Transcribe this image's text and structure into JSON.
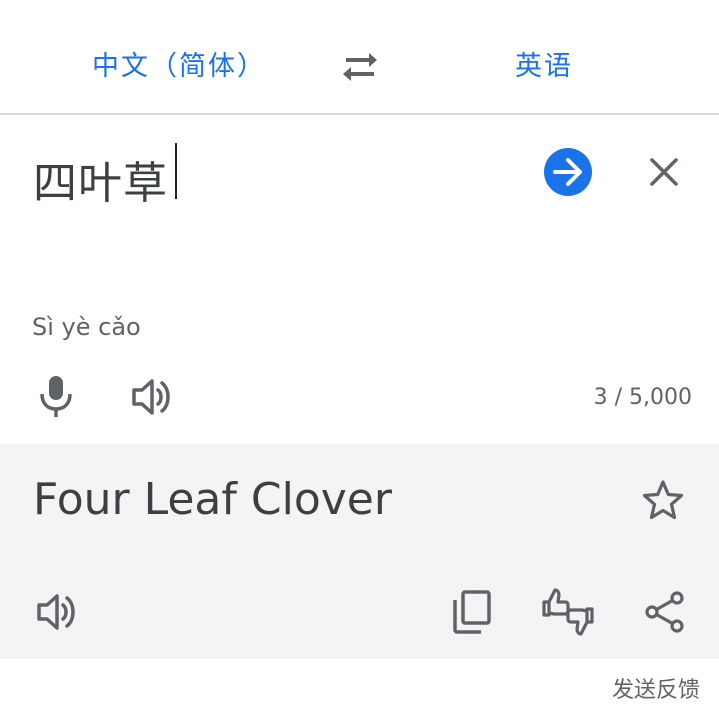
{
  "language_bar": {
    "source_language": "中文（简体）",
    "target_language": "英语",
    "swap_icon": "swap-arrows-icon"
  },
  "input": {
    "source_text": "四叶草",
    "transliteration": "Sì yè cǎo",
    "char_count": "3 / 5,000",
    "go_icon": "arrow-forward-icon",
    "clear_icon": "close-icon",
    "mic_icon": "microphone-icon",
    "speaker_icon": "speaker-icon"
  },
  "result": {
    "translated_text": "Four Leaf Clover",
    "star_icon": "star-outline-icon",
    "speaker_icon": "speaker-icon",
    "copy_icon": "copy-icon",
    "rate_icon": "thumbs-up-down-icon",
    "share_icon": "share-icon"
  },
  "footer": {
    "feedback_label": "发送反馈"
  },
  "colors": {
    "accent": "#1a73e8",
    "text": "#3c4043",
    "secondary_text": "#5f6368",
    "result_bg": "#f4f4f4",
    "divider": "#dadce0"
  }
}
